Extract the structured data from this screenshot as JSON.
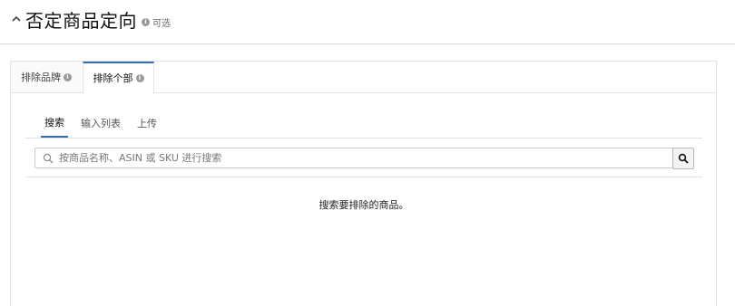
{
  "header": {
    "title": "否定商品定向",
    "info_icon": "i",
    "optional": "可选"
  },
  "tabs": [
    {
      "label": "排除品牌",
      "info_icon": "i",
      "active": false
    },
    {
      "label": "排除个部",
      "info_icon": "i",
      "active": true
    }
  ],
  "subtabs": [
    {
      "label": "搜索",
      "active": true
    },
    {
      "label": "输入列表",
      "active": false
    },
    {
      "label": "上传",
      "active": false
    }
  ],
  "search": {
    "placeholder": "按商品名称、ASIN 或 SKU 进行搜索",
    "value": ""
  },
  "results": {
    "empty_message": "搜索要排除的商品。"
  },
  "colors": {
    "accent": "#336ea8",
    "border": "#e3e3e3"
  }
}
